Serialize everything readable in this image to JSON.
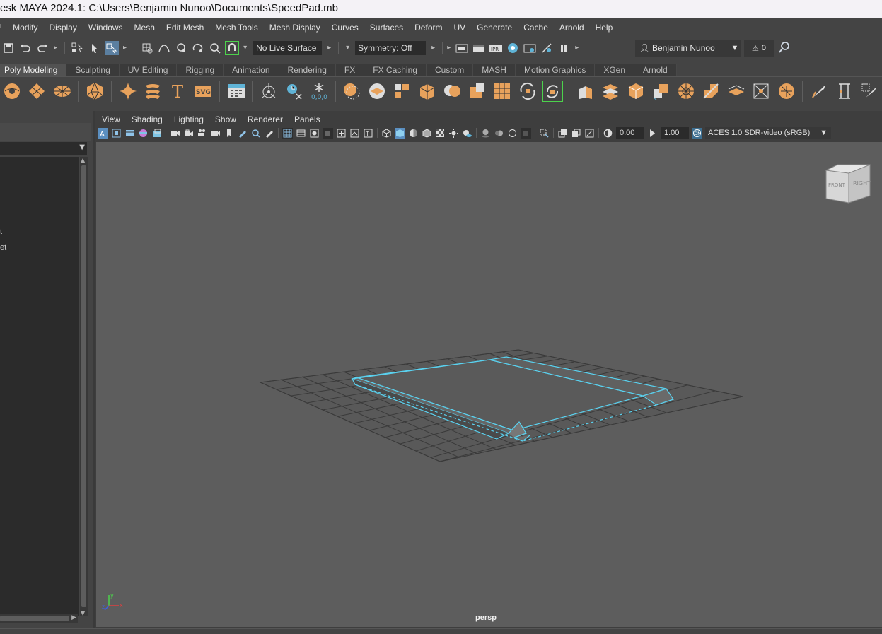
{
  "window": {
    "title": "esk MAYA 2024.1: C:\\Users\\Benjamin Nunoo\\Documents\\SpeedPad.mb"
  },
  "menubar": {
    "items": [
      "Modify",
      "Display",
      "Windows",
      "Mesh",
      "Edit Mesh",
      "Mesh Tools",
      "Mesh Display",
      "Curves",
      "Surfaces",
      "Deform",
      "UV",
      "Generate",
      "Cache",
      "Arnold",
      "Help"
    ]
  },
  "statusline": {
    "live_surface": "No Live Surface",
    "symmetry": "Symmetry: Off",
    "user_name": "Benjamin Nunoo",
    "warnings_count": "0"
  },
  "shelf": {
    "tabs": [
      "Poly Modeling",
      "Sculpting",
      "UV Editing",
      "Rigging",
      "Animation",
      "Rendering",
      "FX",
      "FX Caching",
      "Custom",
      "MASH",
      "Motion Graphics",
      "XGen",
      "Arnold"
    ],
    "active_tab": "Poly Modeling",
    "text_icon_label": "T",
    "svg_icon_label": "SVG"
  },
  "left_panel": {
    "partial_items": [
      "t",
      "et"
    ]
  },
  "viewport": {
    "menus": [
      "View",
      "Shading",
      "Lighting",
      "Show",
      "Renderer",
      "Panels"
    ],
    "exposure": "0.00",
    "gamma": "1.00",
    "color_space": "ACES 1.0 SDR-video (sRGB)",
    "camera": "persp",
    "viewcube": {
      "front": "FRONT",
      "right": "RIGHT"
    },
    "axis": {
      "x": "x",
      "y": "y",
      "z": "z"
    },
    "wireframe_color": "#5ad2f0",
    "grid_color": "#3a3a3a"
  },
  "colors": {
    "shelf_icon_orange": "#e8a25c",
    "active_highlight": "#5fb3d6",
    "ui_background": "#444444",
    "viewport_background": "#5d5d5d"
  }
}
